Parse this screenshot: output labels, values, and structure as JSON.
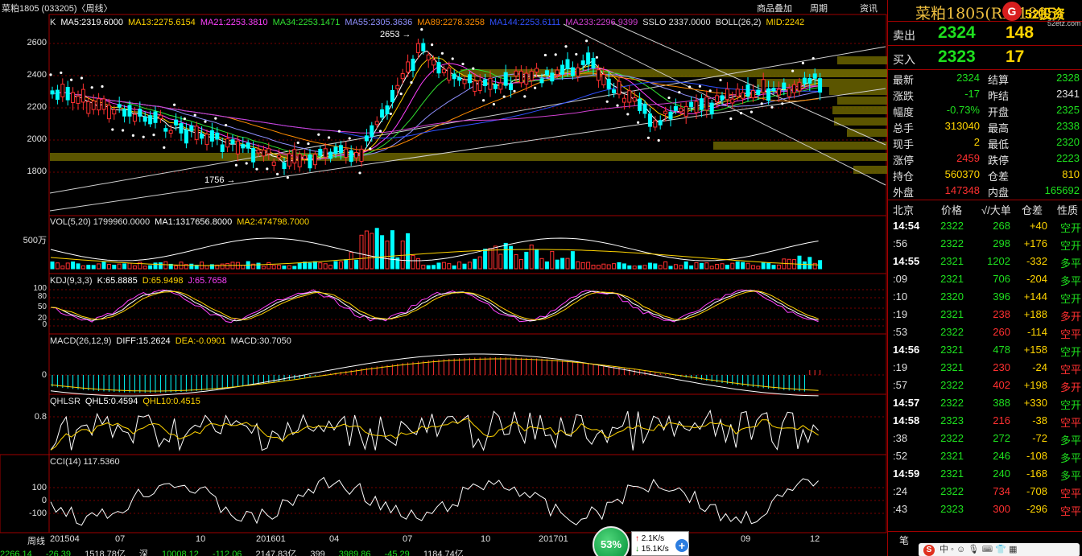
{
  "header": {
    "title": "菜粕1805 (033205)〈周线〉",
    "links": [
      "商品叠加",
      "周期",
      "资讯"
    ]
  },
  "indicators": {
    "ma": [
      {
        "text": "K",
        "color": "#e0e0e0"
      },
      {
        "text": "MA5:2319.6000",
        "color": "#ffffff"
      },
      {
        "text": "MA13:2275.6154",
        "color": "#ffd400"
      },
      {
        "text": "MA21:2253.3810",
        "color": "#ff40ff"
      },
      {
        "text": "MA34:2253.1471",
        "color": "#30e030"
      },
      {
        "text": "MA55:2305.3636",
        "color": "#9090ff"
      },
      {
        "text": "MA89:2278.3258",
        "color": "#ff8c00"
      },
      {
        "text": "MA144:2253.6111",
        "color": "#3050ff"
      },
      {
        "text": "MA233:2296.9399",
        "color": "#d040d0"
      },
      {
        "text": "SSLO 2337.0000",
        "color": "#e0e0e0"
      },
      {
        "text": "BOLL(26,2)",
        "color": "#e0e0e0"
      },
      {
        "text": "MID:2242",
        "color": "#ffd400"
      }
    ],
    "vol": [
      {
        "text": "VOL(5,20) 1799960.0000",
        "color": "#e0e0e0"
      },
      {
        "text": "MA1:1317656.8000",
        "color": "#ffffff"
      },
      {
        "text": "MA2:474798.7000",
        "color": "#ffd400"
      }
    ],
    "kdj": [
      {
        "text": "KDJ(9,3,3)",
        "color": "#e0e0e0"
      },
      {
        "text": "K:65.8885",
        "color": "#ffffff"
      },
      {
        "text": "D:65.9498",
        "color": "#ffd400"
      },
      {
        "text": "J:65.7658",
        "color": "#ff40ff"
      }
    ],
    "macd": [
      {
        "text": "MACD(26,12,9)",
        "color": "#e0e0e0"
      },
      {
        "text": "DIFF:15.2624",
        "color": "#ffffff"
      },
      {
        "text": "DEA:-0.0901",
        "color": "#ffd400"
      },
      {
        "text": "MACD:30.7050",
        "color": "#e0e0e0"
      }
    ],
    "qhlsr": [
      {
        "text": "QHLSR",
        "color": "#e0e0e0"
      },
      {
        "text": "QHL5:0.4594",
        "color": "#ffffff"
      },
      {
        "text": "QHL10:0.4515",
        "color": "#ffd400"
      }
    ],
    "cci": [
      {
        "text": "CCI(14) 117.5360",
        "color": "#e0e0e0"
      }
    ]
  },
  "axes": {
    "price": [
      "2600",
      "2400",
      "2200",
      "2000",
      "1800"
    ],
    "vol": [
      "500万"
    ],
    "kdj": [
      "100",
      "80",
      "50",
      "20",
      "0"
    ],
    "macd": [
      "0"
    ],
    "qhlsr": [
      "0.8"
    ],
    "cci": [
      "100",
      "0",
      "-100"
    ],
    "dates": [
      "周线",
      "201504",
      "07",
      "10",
      "201601",
      "04",
      "07",
      "10",
      "201701",
      "04",
      "07",
      "09",
      "12"
    ]
  },
  "annotations": {
    "high": "2653",
    "low": "1756"
  },
  "status_bar": [
    "2266.14",
    "-26.39",
    "1518.78亿",
    "深",
    "10008.12",
    "-112.06",
    "2147.83亿",
    "399",
    "3989.86",
    "-45.29",
    "1184.74亿"
  ],
  "badge": {
    "percent": "53%",
    "up_speed": "2.1K/s",
    "down_speed": "15.1K/s"
  },
  "quote_panel": {
    "contract": "菜粕1805(RM1805)",
    "logo": {
      "mark": "G",
      "name": "52投资",
      "domain": "52etz.com"
    },
    "ask": {
      "label": "卖出",
      "price": "2324",
      "volume": "148"
    },
    "bid": {
      "label": "买入",
      "price": "2323",
      "volume": "17"
    },
    "stats": [
      {
        "k1": "最新",
        "v1": "2324",
        "c1": "green",
        "k2": "结算",
        "v2": "2328",
        "c2": "green"
      },
      {
        "k1": "涨跌",
        "v1": "-17",
        "c1": "green",
        "k2": "昨结",
        "v2": "2341",
        "c2": "white"
      },
      {
        "k1": "幅度",
        "v1": "-0.73%",
        "c1": "green",
        "k2": "开盘",
        "v2": "2325",
        "c2": "green"
      },
      {
        "k1": "总手",
        "v1": "313040",
        "c1": "yellow",
        "k2": "最高",
        "v2": "2338",
        "c2": "green"
      },
      {
        "k1": "现手",
        "v1": "2",
        "c1": "yellow",
        "k2": "最低",
        "v2": "2320",
        "c2": "green"
      },
      {
        "k1": "涨停",
        "v1": "2459",
        "c1": "red",
        "k2": "跌停",
        "v2": "2223",
        "c2": "green"
      },
      {
        "k1": "持仓",
        "v1": "560370",
        "c1": "yellow",
        "k2": "仓差",
        "v2": "810",
        "c2": "yellow"
      },
      {
        "k1": "外盘",
        "v1": "147348",
        "c1": "red",
        "k2": "内盘",
        "v2": "165692",
        "c2": "green"
      }
    ],
    "tick_header": {
      "time": "北京",
      "price": "价格",
      "vol": "√/大单",
      "oi": "仓差",
      "nature": "性质"
    },
    "ticks": [
      {
        "t": "14:54",
        "major": true,
        "p": "2322",
        "v": "268",
        "vc": "green",
        "oi": "+40",
        "oc": "yellow",
        "n": "空开",
        "nc": "green"
      },
      {
        "t": ":56",
        "major": false,
        "p": "2322",
        "v": "298",
        "vc": "green",
        "oi": "+176",
        "oc": "yellow",
        "n": "空开",
        "nc": "green"
      },
      {
        "t": "14:55",
        "major": true,
        "p": "2321",
        "v": "1202",
        "vc": "green",
        "oi": "-332",
        "oc": "yellow",
        "n": "多平",
        "nc": "green"
      },
      {
        "t": ":09",
        "major": false,
        "p": "2321",
        "v": "706",
        "vc": "green",
        "oi": "-204",
        "oc": "yellow",
        "n": "多平",
        "nc": "green"
      },
      {
        "t": ":10",
        "major": false,
        "p": "2320",
        "v": "396",
        "vc": "green",
        "oi": "+144",
        "oc": "yellow",
        "n": "空开",
        "nc": "green"
      },
      {
        "t": ":19",
        "major": false,
        "p": "2321",
        "v": "238",
        "vc": "red",
        "oi": "+188",
        "oc": "yellow",
        "n": "多开",
        "nc": "red"
      },
      {
        "t": ":53",
        "major": false,
        "p": "2322",
        "v": "260",
        "vc": "red",
        "oi": "-114",
        "oc": "yellow",
        "n": "空平",
        "nc": "red"
      },
      {
        "t": "14:56",
        "major": true,
        "p": "2321",
        "v": "478",
        "vc": "green",
        "oi": "+158",
        "oc": "yellow",
        "n": "空开",
        "nc": "green"
      },
      {
        "t": ":19",
        "major": false,
        "p": "2321",
        "v": "230",
        "vc": "red",
        "oi": "-24",
        "oc": "yellow",
        "n": "空平",
        "nc": "red"
      },
      {
        "t": ":57",
        "major": false,
        "p": "2322",
        "v": "402",
        "vc": "red",
        "oi": "+198",
        "oc": "yellow",
        "n": "多开",
        "nc": "red"
      },
      {
        "t": "14:57",
        "major": true,
        "p": "2322",
        "v": "388",
        "vc": "green",
        "oi": "+330",
        "oc": "yellow",
        "n": "空开",
        "nc": "green"
      },
      {
        "t": "14:58",
        "major": true,
        "p": "2323",
        "v": "216",
        "vc": "red",
        "oi": "-38",
        "oc": "yellow",
        "n": "空平",
        "nc": "red"
      },
      {
        "t": ":38",
        "major": false,
        "p": "2322",
        "v": "272",
        "vc": "green",
        "oi": "-72",
        "oc": "yellow",
        "n": "多平",
        "nc": "green"
      },
      {
        "t": ":52",
        "major": false,
        "p": "2321",
        "v": "246",
        "vc": "green",
        "oi": "-108",
        "oc": "yellow",
        "n": "多平",
        "nc": "green"
      },
      {
        "t": "14:59",
        "major": true,
        "p": "2321",
        "v": "240",
        "vc": "green",
        "oi": "-168",
        "oc": "yellow",
        "n": "多平",
        "nc": "green"
      },
      {
        "t": ":24",
        "major": false,
        "p": "2322",
        "v": "734",
        "vc": "red",
        "oi": "-708",
        "oc": "yellow",
        "n": "空平",
        "nc": "red"
      },
      {
        "t": ":43",
        "major": false,
        "p": "2323",
        "v": "300",
        "vc": "red",
        "oi": "-296",
        "oc": "yellow",
        "n": "空平",
        "nc": "red"
      }
    ],
    "footer_label": "笔",
    "ime_text": "中 ◦ ☺ 🎙 ⌨ 👕 ▦"
  }
}
